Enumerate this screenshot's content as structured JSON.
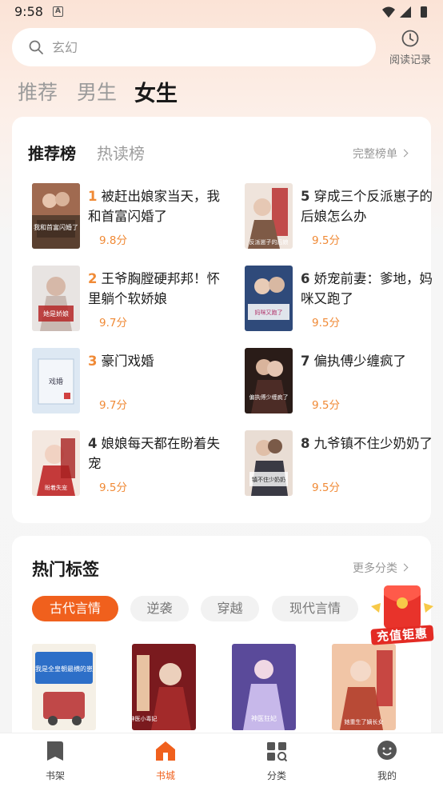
{
  "status_bar": {
    "time": "9:58",
    "notification_icon": "A"
  },
  "search": {
    "placeholder": "玄幻"
  },
  "history": {
    "label": "阅读记录",
    "icon": "clock-icon"
  },
  "gender_tabs": [
    {
      "label": "推荐",
      "active": false
    },
    {
      "label": "男生",
      "active": false
    },
    {
      "label": "女生",
      "active": true
    }
  ],
  "ranking": {
    "tabs": [
      {
        "label": "推荐榜",
        "active": true
      },
      {
        "label": "热读榜",
        "active": false
      }
    ],
    "more_label": "完整榜单",
    "books": [
      {
        "rank": "1",
        "title": "被赶出娘家当天，我和首富闪婚了",
        "score": "9.8分"
      },
      {
        "rank": "2",
        "title": "王爷胸膛硬邦邦！怀里躺个软娇娘",
        "score": "9.7分"
      },
      {
        "rank": "3",
        "title": "豪门戏婚",
        "score": "9.7分"
      },
      {
        "rank": "4",
        "title": "娘娘每天都在盼着失宠",
        "score": "9.5分"
      },
      {
        "rank": "5",
        "title": "穿成三个反派崽子的后娘怎么办",
        "score": "9.5分"
      },
      {
        "rank": "6",
        "title": "娇宠前妻：爹地，妈咪又跑了",
        "score": "9.5分"
      },
      {
        "rank": "7",
        "title": "偏执傅少缠疯了",
        "score": "9.5分"
      },
      {
        "rank": "8",
        "title": "九爷镇不住少奶奶了",
        "score": "9.5分"
      }
    ],
    "cover_texts": [
      "我和首富闪婚了",
      "她是娇娘",
      "戏婚",
      "盼着失宠",
      "反派崽子的后娘",
      "妈咪又跑了",
      "偏执傅少缠疯了",
      "镇不住少奶奶"
    ]
  },
  "hot_tags": {
    "title": "热门标签",
    "more_label": "更多分类",
    "tags": [
      {
        "label": "古代言情",
        "active": true
      },
      {
        "label": "逆袭",
        "active": false
      },
      {
        "label": "穿越",
        "active": false
      },
      {
        "label": "现代言情",
        "active": false
      }
    ],
    "cover_texts": [
      "我是全皇朝最横的崽",
      "神医小毒妃",
      "神医狂妃",
      "她重生了嫡长女"
    ]
  },
  "recharge_badge": {
    "label": "充值钜惠"
  },
  "bottom_nav": [
    {
      "label": "书架",
      "icon": "bookshelf-icon",
      "active": false
    },
    {
      "label": "书城",
      "icon": "bookstore-icon",
      "active": true
    },
    {
      "label": "分类",
      "icon": "category-icon",
      "active": false
    },
    {
      "label": "我的",
      "icon": "profile-icon",
      "active": false
    }
  ],
  "colors": {
    "accent": "#f0601d",
    "rank_top": "#f08a36",
    "score": "#f08a36"
  }
}
